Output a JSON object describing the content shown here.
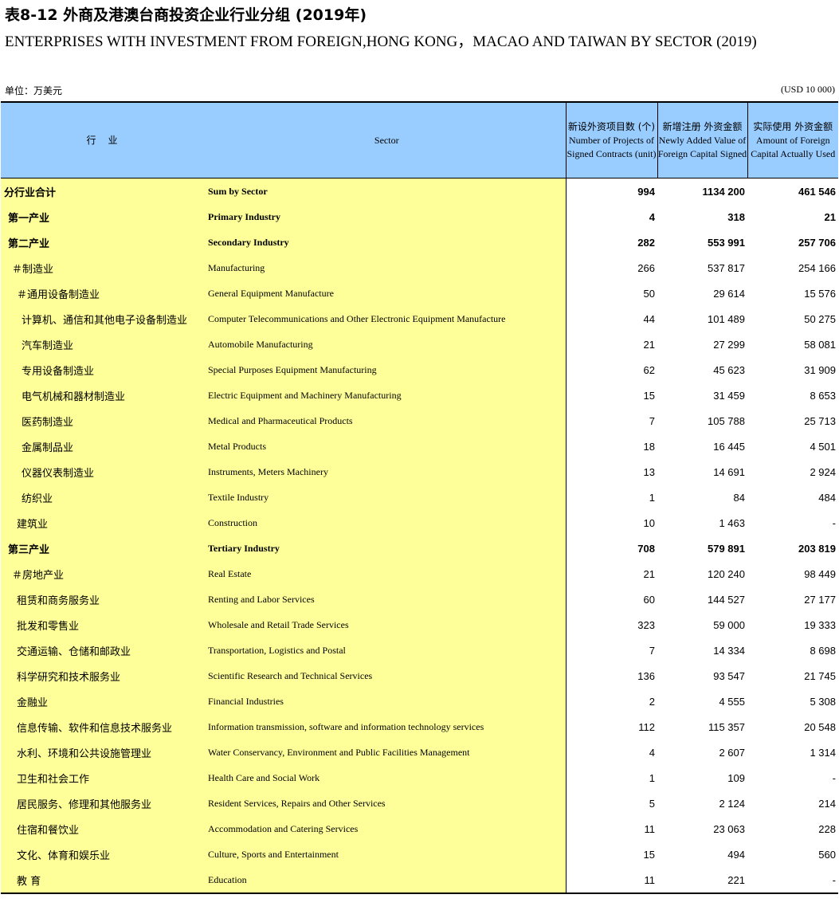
{
  "title_cn": "表8-12 外商及港澳台商投资企业行业分组 (2019年)",
  "title_en": "ENTERPRISES WITH INVESTMENT FROM FOREIGN,HONG  KONG，MACAO AND TAIWAN BY SECTOR (2019)",
  "unit_cn": "单位：万美元",
  "unit_en": "(USD 10 000)",
  "headers": {
    "industry_cn": "行 业",
    "sector_en": "Sector",
    "projects_cn": "新设外资项目数 (个)",
    "projects_en": "Number of Projects of Signed Contracts (unit)",
    "newvalue_cn": "新增注册 外资金额",
    "newvalue_en": "Newly Added Value of Foreign Capital Signed",
    "actual_cn": "实际使用 外资金额",
    "actual_en": "Amount of Foreign Capital Actually Used"
  },
  "rows": [
    {
      "cn": "分行业合计",
      "en": "Sum by Sector",
      "projects": "994",
      "newval": "1134 200",
      "actual": "461 546",
      "bold": true,
      "indent": 0
    },
    {
      "cn": "第一产业",
      "en": "Primary Industry",
      "projects": "4",
      "newval": "318",
      "actual": "21",
      "bold": true,
      "indent": 1
    },
    {
      "cn": "第二产业",
      "en": "Secondary Industry",
      "projects": "282",
      "newval": "553 991",
      "actual": "257 706",
      "bold": true,
      "indent": 1
    },
    {
      "cn": "＃制造业",
      "en": "Manufacturing",
      "projects": "266",
      "newval": "537 817",
      "actual": "254 166",
      "bold": false,
      "indent": 2
    },
    {
      "cn": "＃通用设备制造业",
      "en": "General Equipment Manufacture",
      "projects": "50",
      "newval": "29 614",
      "actual": "15 576",
      "bold": false,
      "indent": 3
    },
    {
      "cn": "计算机、通信和其他电子设备制造业",
      "en": "Computer Telecommunications and Other Electronic Equipment Manufacture",
      "projects": "44",
      "newval": "101 489",
      "actual": "50 275",
      "bold": false,
      "indent": 4
    },
    {
      "cn": "汽车制造业",
      "en": "Automobile Manufacturing",
      "projects": "21",
      "newval": "27 299",
      "actual": "58 081",
      "bold": false,
      "indent": 4
    },
    {
      "cn": "专用设备制造业",
      "en": "Special Purposes Equipment Manufacturing",
      "projects": "62",
      "newval": "45 623",
      "actual": "31 909",
      "bold": false,
      "indent": 4
    },
    {
      "cn": "电气机械和器材制造业",
      "en": "Electric Equipment and Machinery Manufacturing",
      "projects": "15",
      "newval": "31 459",
      "actual": "8 653",
      "bold": false,
      "indent": 4
    },
    {
      "cn": "医药制造业",
      "en": "Medical and Pharmaceutical Products",
      "projects": "7",
      "newval": "105 788",
      "actual": "25 713",
      "bold": false,
      "indent": 4
    },
    {
      "cn": "金属制品业",
      "en": "Metal Products",
      "projects": "18",
      "newval": "16 445",
      "actual": "4 501",
      "bold": false,
      "indent": 4
    },
    {
      "cn": "仪器仪表制造业",
      "en": "Instruments, Meters Machinery",
      "projects": "13",
      "newval": "14 691",
      "actual": "2 924",
      "bold": false,
      "indent": 4
    },
    {
      "cn": "纺织业",
      "en": "Textile Industry",
      "projects": "1",
      "newval": "84",
      "actual": "484",
      "bold": false,
      "indent": 4
    },
    {
      "cn": "建筑业",
      "en": "Construction",
      "projects": "10",
      "newval": "1 463",
      "actual": "-",
      "bold": false,
      "indent": 3
    },
    {
      "cn": "第三产业",
      "en": "Tertiary Industry",
      "projects": "708",
      "newval": "579 891",
      "actual": "203 819",
      "bold": true,
      "indent": 1
    },
    {
      "cn": "＃房地产业",
      "en": "Real Estate",
      "projects": "21",
      "newval": "120 240",
      "actual": "98 449",
      "bold": false,
      "indent": 2
    },
    {
      "cn": "租赁和商务服务业",
      "en": "Renting and Labor Services",
      "projects": "60",
      "newval": "144 527",
      "actual": "27 177",
      "bold": false,
      "indent": 3
    },
    {
      "cn": "批发和零售业",
      "en": "Wholesale and Retail Trade Services",
      "projects": "323",
      "newval": "59 000",
      "actual": "19 333",
      "bold": false,
      "indent": 3
    },
    {
      "cn": "交通运输、仓储和邮政业",
      "en": "Transportation, Logistics and Postal",
      "projects": "7",
      "newval": "14 334",
      "actual": "8 698",
      "bold": false,
      "indent": 3
    },
    {
      "cn": "科学研究和技术服务业",
      "en": "Scientific Research and Technical Services",
      "projects": "136",
      "newval": "93 547",
      "actual": "21 745",
      "bold": false,
      "indent": 3
    },
    {
      "cn": "金融业",
      "en": "Financial Industries",
      "projects": "2",
      "newval": "4 555",
      "actual": "5 308",
      "bold": false,
      "indent": 3
    },
    {
      "cn": "信息传输、软件和信息技术服务业",
      "en": "Information transmission, software and information technology services",
      "projects": "112",
      "newval": "115 357",
      "actual": "20 548",
      "bold": false,
      "indent": 3
    },
    {
      "cn": "水利、环境和公共设施管理业",
      "en": "Water Conservancy, Environment and Public Facilities Management",
      "projects": "4",
      "newval": "2 607",
      "actual": "1 314",
      "bold": false,
      "indent": 3
    },
    {
      "cn": "卫生和社会工作",
      "en": "Health Care and Social Work",
      "projects": "1",
      "newval": "109",
      "actual": "-",
      "bold": false,
      "indent": 3
    },
    {
      "cn": "居民服务、修理和其他服务业",
      "en": "Resident Services, Repairs and Other Services",
      "projects": "5",
      "newval": "2 124",
      "actual": "214",
      "bold": false,
      "indent": 3
    },
    {
      "cn": "住宿和餐饮业",
      "en": "Accommodation  and Catering Services",
      "projects": "11",
      "newval": "23 063",
      "actual": "228",
      "bold": false,
      "indent": 3
    },
    {
      "cn": "文化、体育和娱乐业",
      "en": "Culture, Sports and Entertainment",
      "projects": "15",
      "newval": "494",
      "actual": "560",
      "bold": false,
      "indent": 3
    },
    {
      "cn": "教 育",
      "en": "Education",
      "projects": "11",
      "newval": "221",
      "actual": "-",
      "bold": false,
      "indent": 3
    }
  ]
}
